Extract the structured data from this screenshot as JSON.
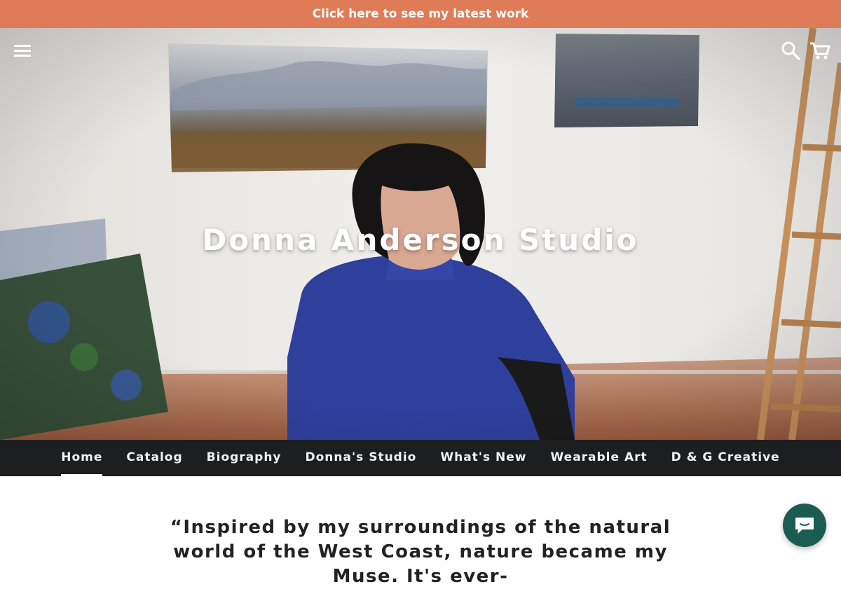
{
  "announcement": {
    "text": "Click here to see my latest work"
  },
  "hero": {
    "title": "Donna Anderson Studio"
  },
  "header": {
    "menu_icon": "hamburger-menu-icon",
    "search_icon": "search-icon",
    "cart_icon": "shopping-cart-icon"
  },
  "nav": {
    "items": [
      {
        "label": "Home",
        "active": true
      },
      {
        "label": "Catalog"
      },
      {
        "label": "Biography"
      },
      {
        "label": "Donna's Studio"
      },
      {
        "label": "What's New"
      },
      {
        "label": "Wearable Art"
      },
      {
        "label": "D & G Creative"
      }
    ]
  },
  "intro": {
    "quote": "“Inspired by my surroundings of the natural world of the West Coast, nature became my Muse. It's ever-"
  },
  "chat": {
    "icon": "chat-bubble-icon"
  },
  "colors": {
    "announcement_bg": "#df7b56",
    "nav_bg": "#1d1e1f",
    "chat_bg": "#1b5c52"
  }
}
